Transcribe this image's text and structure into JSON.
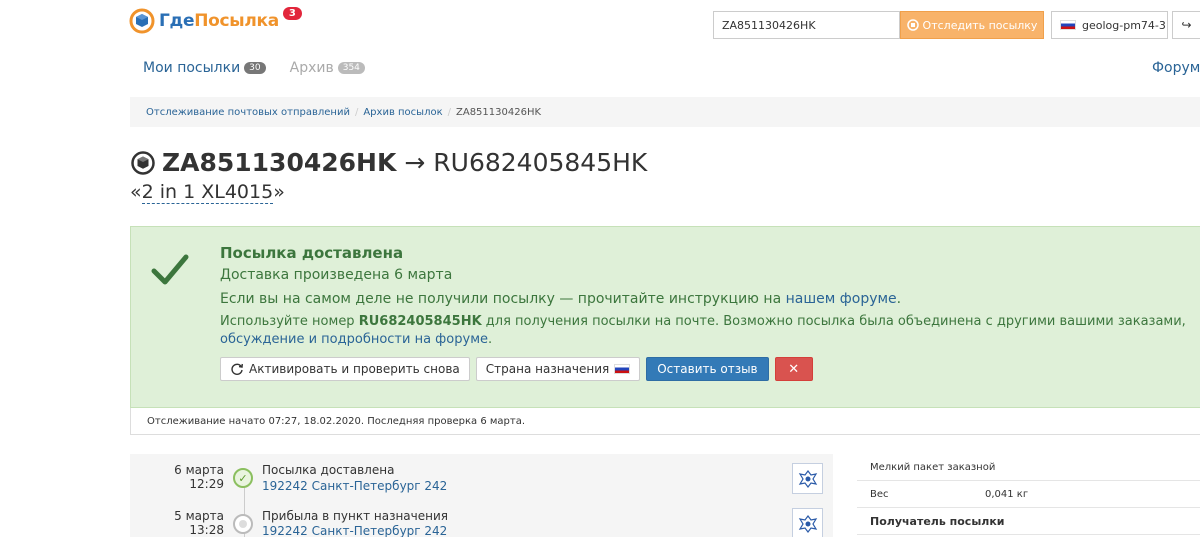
{
  "header": {
    "logo_part1": "Где",
    "logo_part2": "Посылка",
    "logo_badge": "3",
    "search_value": "ZA851130426HK",
    "track_label": "Отследить посылку",
    "user_name": "geolog-pm74-3",
    "logout_icon": "↪"
  },
  "nav": {
    "my_parcels": "Мои посылки",
    "my_parcels_count": "30",
    "archive": "Архив",
    "archive_count": "354",
    "forum": "Форум"
  },
  "breadcrumb": {
    "item1": "Отслеживание почтовых отправлений",
    "item2": "Архив посылок",
    "current": "ZA851130426HK",
    "separator": "/"
  },
  "parcel": {
    "number": "ZA851130426HK",
    "arrow": "→",
    "alt_number": "RU682405845HK",
    "name_open": "«",
    "name": "2 in 1 XL4015",
    "name_close": "»"
  },
  "status": {
    "title": "Посылка доставлена",
    "delivered": "Доставка произведена 6 марта",
    "not_received_prefix": "Если вы на самом деле не получили посылку — прочитайте инструкцию на",
    "not_received_link": "нашем форуме",
    "not_received_suffix": ".",
    "use_prefix": "Используйте номер",
    "use_number": "RU682405845HK",
    "use_middle": "для получения посылки на почте. Возможно посылка была объединена с другими вашими заказами,",
    "use_link": "обсуждение и подробности на форуме",
    "use_suffix": ".",
    "btn_reactivate": "Активировать и проверить снова",
    "btn_country": "Страна назначения",
    "btn_review": "Оставить отзыв",
    "btn_close": "✕"
  },
  "tracking_info": "Отслеживание начато 07:27, 18.02.2020. Последняя проверка 6 марта.",
  "events": [
    {
      "date": "6 марта",
      "time": "12:29",
      "title": "Посылка доставлена",
      "place": "192242 Санкт-Петербург 242",
      "done": true
    },
    {
      "date": "5 марта",
      "time": "13:28",
      "title": "Прибыла в пункт назначения",
      "place": "192242 Санкт-Петербург 242",
      "done": false
    }
  ],
  "side": {
    "type": "Мелкий пакет заказной",
    "weight_label": "Вес",
    "weight_value": "0,041 кг",
    "recipient_heading": "Получатель посылки"
  },
  "colors": {
    "accent": "#2a6496",
    "orange": "#f8b36a",
    "success_bg": "#dff0d8",
    "success_text": "#3c763d"
  }
}
